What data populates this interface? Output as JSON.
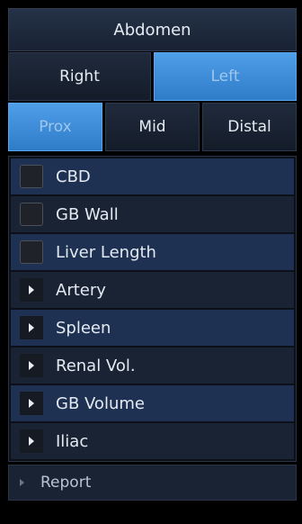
{
  "panel": {
    "title": "Abdomen"
  },
  "side_tabs": [
    {
      "label": "Right",
      "active": false
    },
    {
      "label": "Left",
      "active": true
    }
  ],
  "position_tabs": [
    {
      "label": "Prox",
      "active": true
    },
    {
      "label": "Mid",
      "active": false
    },
    {
      "label": "Distal",
      "active": false
    }
  ],
  "measurements": [
    {
      "label": "CBD",
      "control": "checkbox",
      "checked": false
    },
    {
      "label": "GB Wall",
      "control": "checkbox",
      "checked": false
    },
    {
      "label": "Liver Length",
      "control": "checkbox",
      "checked": false
    },
    {
      "label": "Artery",
      "control": "expand-arrow",
      "expanded": false
    },
    {
      "label": "Spleen",
      "control": "expand-arrow",
      "expanded": false
    },
    {
      "label": "Renal Vol.",
      "control": "expand-arrow",
      "expanded": false
    },
    {
      "label": "GB Volume",
      "control": "expand-arrow",
      "expanded": false
    },
    {
      "label": "Iliac",
      "control": "expand-arrow",
      "expanded": false
    }
  ],
  "report": {
    "label": "Report"
  },
  "colors": {
    "active_tab": "#3f8ed9",
    "row_highlight": "#1f3152",
    "row_dark": "#1a2333"
  }
}
